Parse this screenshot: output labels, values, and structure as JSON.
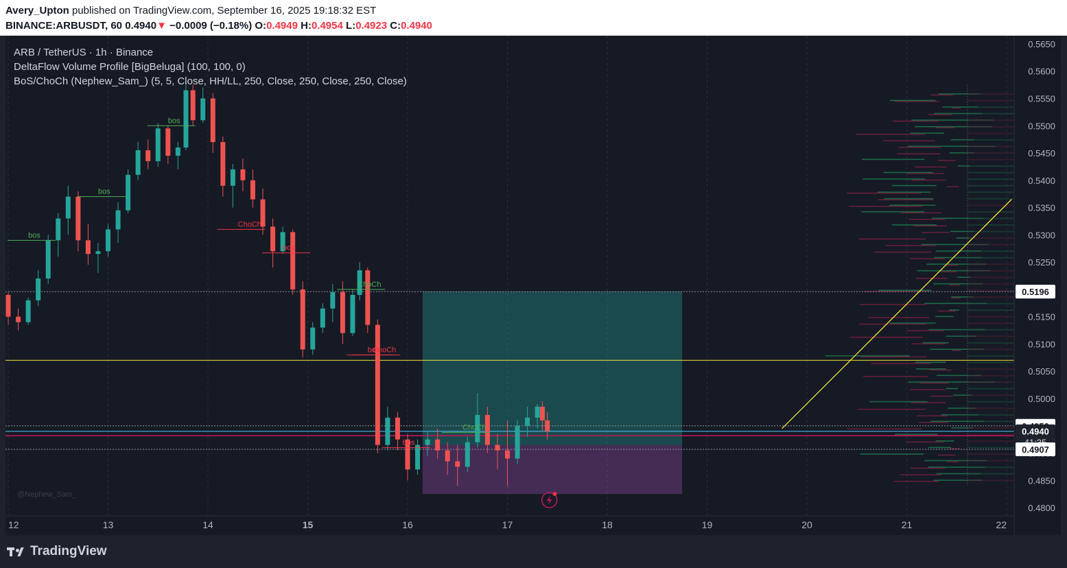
{
  "header": {
    "author": "Avery_Upton",
    "published_text": "published on TradingView.com, September 16, 2025 19:18:32 EST",
    "symbol": "BINANCE:ARBUSDT, 60",
    "last": "0.4940",
    "change_arrow": "▼",
    "change": "−0.0009 (−0.18%)",
    "o_label": "O:",
    "o": "0.4949",
    "h_label": "H:",
    "h": "0.4954",
    "l_label": "L:",
    "l": "0.4923",
    "c_label": "C:",
    "c": "0.4940"
  },
  "legend": {
    "title": "ARB / TetherUS · 1h · Binance",
    "indicator1": "DeltaFlow Volume Profile [BigBeluga] (100, 100, 0)",
    "indicator2": "BoS/ChoCh (Nephew_Sam_) (5, 5, Close, HH/LL, 250, Close, 250, Close, 250, Close)"
  },
  "watermark": "@Nephew_Sam_",
  "footer": {
    "brand": "TradingView"
  },
  "colors": {
    "up": "#26a69a",
    "down": "#ef5350",
    "blue_bar": "#2962ff",
    "orange_bar": "#c9a227",
    "purple_bar": "#9c27b0",
    "trendline": "#f7e33a",
    "bos_green": "#4caf50",
    "choch_red": "#f23645"
  },
  "chart_data": {
    "type": "candlestick",
    "x_ticks": [
      "12",
      "13",
      "14",
      "15",
      "16",
      "17",
      "18",
      "19",
      "20",
      "21",
      "22"
    ],
    "bold_ticks": [
      "15"
    ],
    "y_ticks": [
      "0.5650",
      "0.5600",
      "0.5550",
      "0.5500",
      "0.5450",
      "0.5400",
      "0.5350",
      "0.5300",
      "0.5250",
      "0.5200",
      "0.5150",
      "0.5100",
      "0.5050",
      "0.5000",
      "0.4950",
      "0.4900",
      "0.4850",
      "0.4800"
    ],
    "ylim": [
      0.4785,
      0.5665
    ],
    "price_labels": [
      {
        "value": 0.5196,
        "text": "0.5196"
      },
      {
        "value": 0.495,
        "text": "0.4950"
      },
      {
        "value": 0.494,
        "text": "0.4940",
        "current": true,
        "countdown": "41:35"
      },
      {
        "value": 0.4907,
        "text": "0.4907"
      }
    ],
    "horizontal_line": 0.507,
    "position_box": {
      "x_start": 16.15,
      "x_end": 18.75,
      "entry": 0.4915,
      "target": 0.5196,
      "stop": 0.4825
    },
    "trendline": [
      {
        "x": 19.75,
        "y": 0.4945
      },
      {
        "x": 22.05,
        "y": 0.5365
      }
    ],
    "structure_labels": [
      {
        "text": "bos",
        "x": 12.2,
        "y": 0.5295,
        "color": "green"
      },
      {
        "text": "bos",
        "x": 12.9,
        "y": 0.5375,
        "color": "green"
      },
      {
        "text": "bos",
        "x": 13.6,
        "y": 0.5505,
        "color": "green"
      },
      {
        "text": "ChoCh",
        "x": 14.3,
        "y": 0.5315,
        "color": "red"
      },
      {
        "text": "bos",
        "x": 14.75,
        "y": 0.5272,
        "color": "red"
      },
      {
        "text": "ChoCh",
        "x": 15.5,
        "y": 0.5205,
        "color": "green"
      },
      {
        "text": "bos",
        "x": 15.6,
        "y": 0.5085,
        "color": "red"
      },
      {
        "text": "ChoCh",
        "x": 15.65,
        "y": 0.5085,
        "color": "red"
      },
      {
        "text": "bos",
        "x": 15.95,
        "y": 0.4915,
        "color": "red"
      },
      {
        "text": "ChoCh",
        "x": 16.55,
        "y": 0.4943,
        "color": "green"
      }
    ],
    "series": [
      {
        "values": [
          [
            12.0,
            0.519,
            0.5195,
            0.5135,
            0.515
          ],
          [
            12.1,
            0.515,
            0.5165,
            0.5125,
            0.514
          ],
          [
            12.2,
            0.514,
            0.5185,
            0.5135,
            0.518
          ],
          [
            12.3,
            0.518,
            0.5235,
            0.517,
            0.522
          ],
          [
            12.4,
            0.522,
            0.53,
            0.521,
            0.529
          ],
          [
            12.5,
            0.529,
            0.534,
            0.526,
            0.533
          ],
          [
            12.6,
            0.533,
            0.539,
            0.53,
            0.537
          ],
          [
            12.7,
            0.537,
            0.538,
            0.527,
            0.529
          ],
          [
            12.8,
            0.529,
            0.532,
            0.5245,
            0.5265
          ],
          [
            12.9,
            0.5265,
            0.5285,
            0.523,
            0.527
          ],
          [
            13.0,
            0.527,
            0.532,
            0.526,
            0.531
          ],
          [
            13.1,
            0.531,
            0.536,
            0.5285,
            0.5345
          ],
          [
            13.2,
            0.5345,
            0.542,
            0.534,
            0.541
          ],
          [
            13.3,
            0.541,
            0.547,
            0.54,
            0.5455
          ],
          [
            13.4,
            0.5455,
            0.5475,
            0.542,
            0.5435
          ],
          [
            13.5,
            0.5435,
            0.5505,
            0.5425,
            0.5495
          ],
          [
            13.6,
            0.5495,
            0.55,
            0.543,
            0.5445
          ],
          [
            13.7,
            0.5445,
            0.547,
            0.542,
            0.546
          ],
          [
            13.78,
            0.546,
            0.5575,
            0.5455,
            0.5565
          ],
          [
            13.85,
            0.5565,
            0.5575,
            0.55,
            0.551
          ],
          [
            13.95,
            0.551,
            0.557,
            0.5505,
            0.555
          ],
          [
            14.05,
            0.555,
            0.556,
            0.545,
            0.547
          ],
          [
            14.15,
            0.547,
            0.548,
            0.537,
            0.539
          ],
          [
            14.25,
            0.539,
            0.543,
            0.535,
            0.542
          ],
          [
            14.35,
            0.542,
            0.544,
            0.538,
            0.54
          ],
          [
            14.45,
            0.54,
            0.542,
            0.535,
            0.5365
          ],
          [
            14.55,
            0.5365,
            0.5385,
            0.53,
            0.5315
          ],
          [
            14.65,
            0.5315,
            0.533,
            0.524,
            0.527
          ],
          [
            14.75,
            0.527,
            0.5315,
            0.5265,
            0.5305
          ],
          [
            14.85,
            0.5305,
            0.531,
            0.519,
            0.52
          ],
          [
            14.95,
            0.52,
            0.5215,
            0.5075,
            0.509
          ],
          [
            15.05,
            0.509,
            0.514,
            0.508,
            0.513
          ],
          [
            15.15,
            0.513,
            0.5175,
            0.512,
            0.5165
          ],
          [
            15.25,
            0.5165,
            0.521,
            0.514,
            0.5195
          ],
          [
            15.35,
            0.5195,
            0.5215,
            0.51,
            0.512
          ],
          [
            15.45,
            0.512,
            0.52,
            0.5115,
            0.519
          ],
          [
            15.52,
            0.519,
            0.525,
            0.518,
            0.5235
          ],
          [
            15.6,
            0.5235,
            0.524,
            0.512,
            0.5135
          ],
          [
            15.7,
            0.5135,
            0.5145,
            0.49,
            0.4915
          ],
          [
            15.8,
            0.4915,
            0.4985,
            0.4905,
            0.4965
          ],
          [
            15.9,
            0.4965,
            0.4975,
            0.4905,
            0.4925
          ],
          [
            16.0,
            0.4925,
            0.4935,
            0.485,
            0.487
          ],
          [
            16.1,
            0.487,
            0.4925,
            0.486,
            0.4915
          ],
          [
            16.2,
            0.4915,
            0.494,
            0.4895,
            0.4925
          ],
          [
            16.3,
            0.4925,
            0.4945,
            0.489,
            0.4905
          ],
          [
            16.4,
            0.4905,
            0.492,
            0.486,
            0.4885
          ],
          [
            16.5,
            0.4885,
            0.4915,
            0.484,
            0.4875
          ],
          [
            16.6,
            0.4875,
            0.493,
            0.4865,
            0.492
          ],
          [
            16.7,
            0.492,
            0.501,
            0.491,
            0.497
          ],
          [
            16.8,
            0.497,
            0.4985,
            0.49,
            0.4915
          ],
          [
            16.9,
            0.4915,
            0.4935,
            0.487,
            0.4905
          ],
          [
            17.0,
            0.4905,
            0.496,
            0.484,
            0.489
          ],
          [
            17.1,
            0.489,
            0.496,
            0.488,
            0.495
          ],
          [
            17.2,
            0.495,
            0.4985,
            0.493,
            0.4965
          ],
          [
            17.3,
            0.4965,
            0.499,
            0.4945,
            0.4985
          ],
          [
            17.35,
            0.4985,
            0.4995,
            0.494,
            0.496
          ],
          [
            17.4,
            0.496,
            0.4975,
            0.4925,
            0.494
          ]
        ]
      }
    ]
  }
}
